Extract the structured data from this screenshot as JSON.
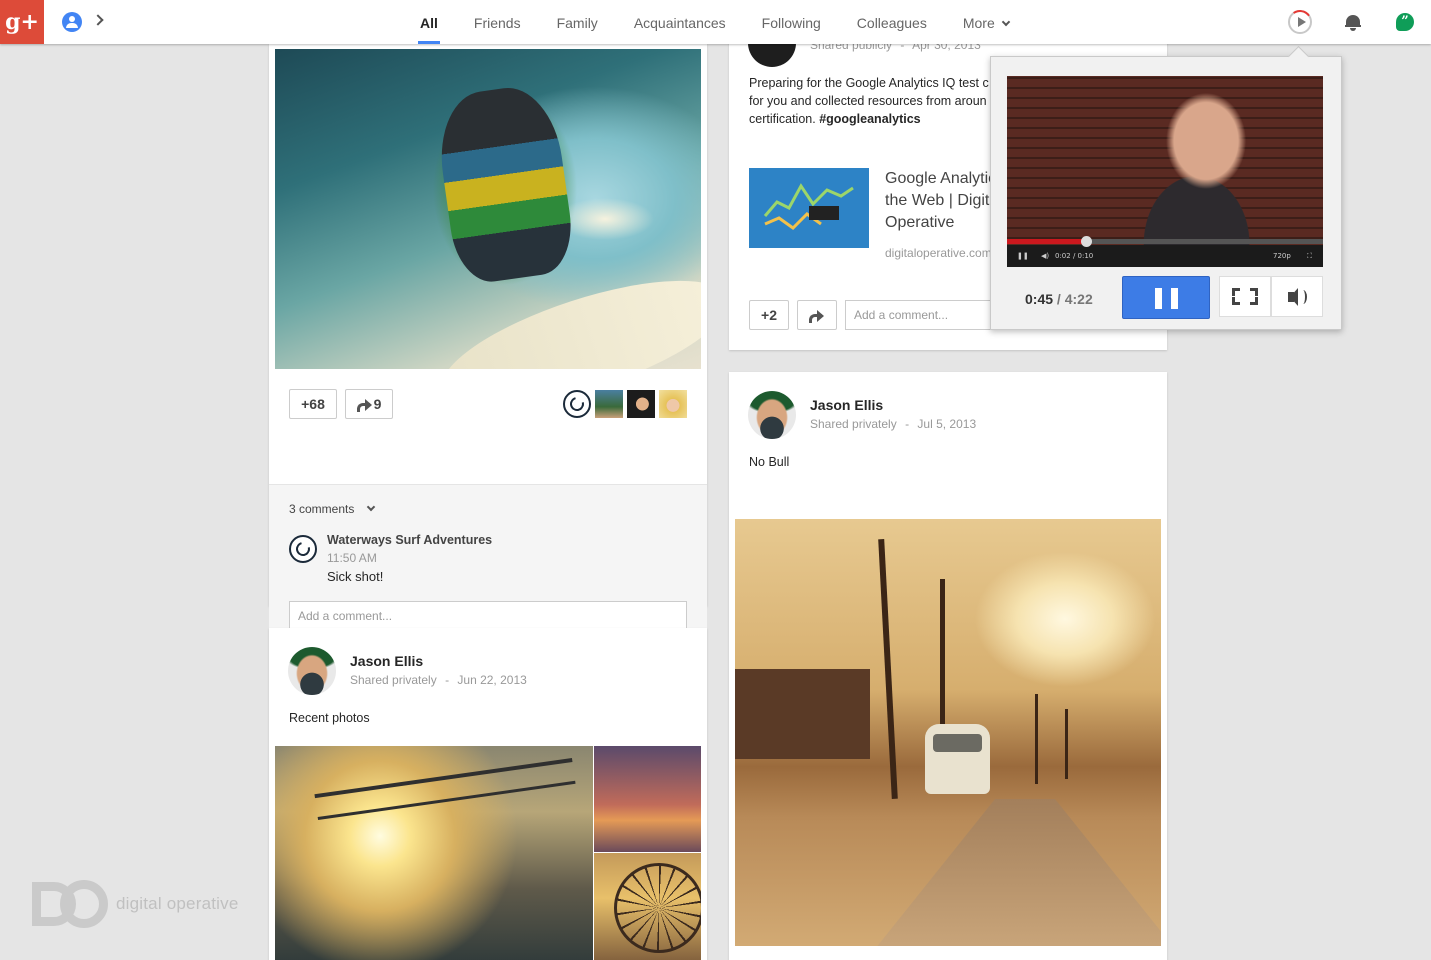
{
  "nav": {
    "logo_label": "g+",
    "tabs": [
      {
        "label": "All",
        "active": true
      },
      {
        "label": "Friends"
      },
      {
        "label": "Family"
      },
      {
        "label": "Acquaintances"
      },
      {
        "label": "Following"
      },
      {
        "label": "Colleagues"
      },
      {
        "label": "More"
      }
    ],
    "icons": [
      "profile-icon",
      "chevron-right-icon",
      "play-activity-icon",
      "notification-bell-icon",
      "hangouts-icon"
    ]
  },
  "surf_post": {
    "plus_count": "+68",
    "share_count": "9",
    "comments_toggle": "3 comments",
    "comment": {
      "author": "Waterways Surf Adventures",
      "time": "11:50 AM",
      "text": "Sick shot!"
    },
    "comment_placeholder": "Add a comment..."
  },
  "analytics_post": {
    "visibility": "Shared publicly",
    "date": "Apr 30, 2013",
    "text_line1": "Preparing for the Google Analytics IQ test c",
    "text_line2": "for you and collected resources from aroun",
    "text_line3_prefix": "certification.",
    "hashtag": "#googleanalytics",
    "link_title_line1": "Google Analytic",
    "link_title_line2": "the Web | Digita",
    "link_title_line3": "Operative",
    "link_domain": "digitaloperative.com",
    "plus_count": "+2",
    "comment_placeholder": "Add a comment..."
  },
  "jason_post_right": {
    "author": "Jason Ellis",
    "visibility": "Shared privately",
    "date": "Jul 5, 2013",
    "text": "No Bull"
  },
  "jason_post_left": {
    "author": "Jason Ellis",
    "visibility": "Shared privately",
    "date": "Jun 22, 2013",
    "text": "Recent photos"
  },
  "video_popup": {
    "current_time": "0:45",
    "separator": " / ",
    "total_time": "4:22",
    "player_time_small": "0:02 / 0:10",
    "quality": "720p",
    "progress": 0.25
  },
  "watermark": {
    "text": "digital operative"
  },
  "colors": {
    "brand_red": "#dd4b39",
    "accent_blue": "#4285f4",
    "pause_blue": "#3d7ce6",
    "hangouts_green": "#0f9d58"
  }
}
